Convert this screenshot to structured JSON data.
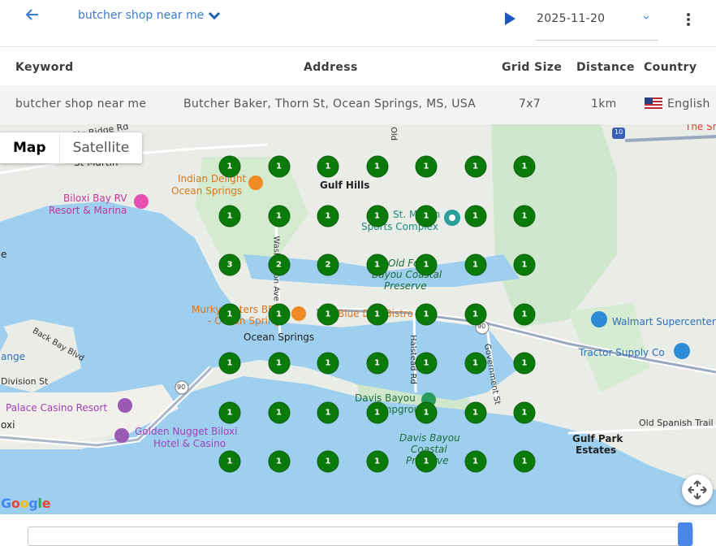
{
  "header": {
    "back_icon": "arrow-left-icon",
    "keyword": "butcher shop near me",
    "date": "2025-11-20",
    "accent_color": "#3a7bd5"
  },
  "table": {
    "columns": [
      "Keyword",
      "Address",
      "Grid Size",
      "Distance",
      "Country"
    ],
    "row": {
      "keyword": "butcher shop near me",
      "address": "Butcher Baker, Thorn St, Ocean Springs, MS, USA",
      "grid_size": "7x7",
      "distance": "1km",
      "country": "English"
    }
  },
  "map": {
    "type_buttons": [
      "Map",
      "Satellite"
    ],
    "active_type": "Map",
    "attribution": "Google",
    "labels": {
      "big_ridge": "Big Ridge Rd",
      "st_martin": "St Martin",
      "indian_delight_1": "Indian Delight",
      "indian_delight_2": "Ocean Springs",
      "gulf_hills": "Gulf Hills",
      "biloxi_rv_1": "Biloxi Bay RV",
      "biloxi_rv_2": "Resort & Marina",
      "sports_1": "St. Martin",
      "sports_2": "Sports Complex",
      "old_fort_1": "Old Fort",
      "old_fort_2": "Bayou Coastal",
      "old_fort_3": "Preserve",
      "murky_1": "Murky Waters BBQ",
      "murky_2": "- Ocean Springs",
      "blue_dog": "Blue Dog Bistro",
      "ocean_springs": "Ocean Springs",
      "walmart": "Walmart Supercenter",
      "tractor": "Tractor Supply Co",
      "back_bay": "Back Bay Blvd",
      "division": "Division St",
      "range": "ange",
      "palace": "Palace Casino Resort",
      "biloxi": "oxi",
      "golden_1": "Golden Nugget Biloxi",
      "golden_2": "Hotel & Casino",
      "davis_camp_1": "Davis Bayou",
      "davis_camp_2": "Campground",
      "davis_pres_1": "Davis Bayou",
      "davis_pres_2": "Coastal",
      "davis_pres_3": "Preserve",
      "gulf_park_1": "Gulf Park",
      "gulf_park_2": "Estates",
      "old_spanish": "Old Spanish Trail",
      "washington": "Washington Ave",
      "halstead": "Halstead Rd",
      "government": "Government St",
      "the_sh": "The Sh",
      "e": "e",
      "old": "Old",
      "hw90": "90",
      "i10": "10"
    },
    "grid_ranks": [
      [
        "1",
        "1",
        "1",
        "1",
        "1",
        "1",
        "1"
      ],
      [
        "1",
        "1",
        "1",
        "1",
        "1",
        "1",
        "1"
      ],
      [
        "3",
        "2",
        "2",
        "1",
        "1",
        "1",
        "1"
      ],
      [
        "1",
        "1",
        "1",
        "1",
        "1",
        "1",
        "1"
      ],
      [
        "1",
        "1",
        "1",
        "1",
        "1",
        "1",
        "1"
      ],
      [
        "1",
        "1",
        "1",
        "1",
        "1",
        "1",
        "1"
      ],
      [
        "1",
        "1",
        "1",
        "1",
        "1",
        "1",
        "1"
      ]
    ],
    "rank_color": "#0a7a0a"
  }
}
